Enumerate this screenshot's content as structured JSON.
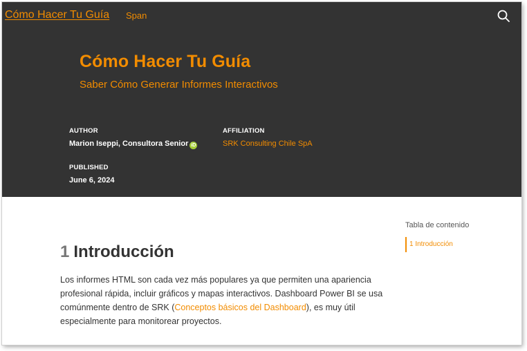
{
  "navbar": {
    "brand": "Cómo Hacer Tu Guía",
    "link": "Span",
    "search_icon": "search-icon"
  },
  "header": {
    "title": "Cómo Hacer Tu Guía",
    "subtitle": "Saber Cómo Generar Informes Interactivos",
    "author_heading": "AUTHOR",
    "author_name": "Marion Iseppi, Consultora Senior",
    "orcid_icon": "orcid-icon",
    "affiliation_heading": "AFFILIATION",
    "affiliation_name": "SRK Consulting Chile SpA",
    "published_heading": "PUBLISHED",
    "published_date": "June 6, 2024"
  },
  "content": {
    "section_number": "1",
    "section_title": "Introducción",
    "paragraph_part1": "Los informes HTML son cada vez más populares ya que permiten una apariencia profesional rápida, incluir gráficos y mapas interactivos. Dashboard Power BI se usa comúnmente dentro de SRK (",
    "paragraph_link": "Conceptos básicos del Dashboard",
    "paragraph_part2": "), es muy útil especialmente para monitorear proyectos."
  },
  "toc": {
    "title": "Tabla de contenido",
    "items": [
      "1 Introducción"
    ]
  },
  "colors": {
    "accent": "#f28c00",
    "header_bg": "#333333",
    "orcid": "#a6ce39"
  }
}
